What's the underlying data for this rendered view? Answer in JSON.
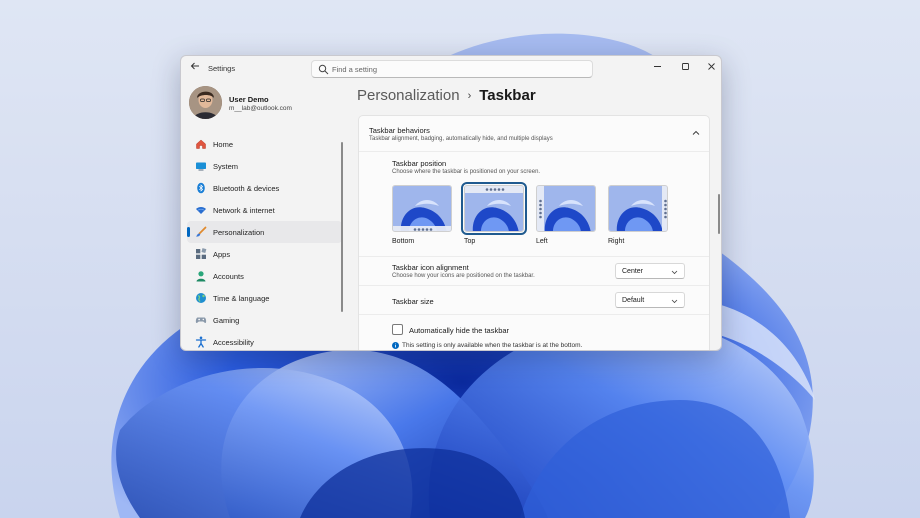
{
  "window": {
    "app_title": "Settings",
    "search_placeholder": "Find a setting"
  },
  "profile": {
    "name": "User Demo",
    "email": "m__lab@outlook.com"
  },
  "sidebar": {
    "items": [
      {
        "label": "Home",
        "icon": "home-icon",
        "color": "#d9534f"
      },
      {
        "label": "System",
        "icon": "system-icon",
        "color": "#1a8fd6"
      },
      {
        "label": "Bluetooth & devices",
        "icon": "bluetooth-icon",
        "color": "#1a7fd6"
      },
      {
        "label": "Network & internet",
        "icon": "wifi-icon",
        "color": "#2a6fd0"
      },
      {
        "label": "Personalization",
        "icon": "brush-icon",
        "color": "#e08a2e"
      },
      {
        "label": "Apps",
        "icon": "apps-icon",
        "color": "#5a6b7f"
      },
      {
        "label": "Accounts",
        "icon": "person-icon",
        "color": "#2aa67a"
      },
      {
        "label": "Time & language",
        "icon": "globe-icon",
        "color": "#1f8fd0"
      },
      {
        "label": "Gaming",
        "icon": "gamepad-icon",
        "color": "#7a8a9a"
      },
      {
        "label": "Accessibility",
        "icon": "accessibility-icon",
        "color": "#1a6fd0"
      }
    ],
    "active_index": 4
  },
  "breadcrumb": {
    "parent": "Personalization",
    "separator": "›",
    "current": "Taskbar"
  },
  "behaviors": {
    "title": "Taskbar behaviors",
    "subtitle": "Taskbar alignment, badging, automatically hide, and multiple displays",
    "position": {
      "title": "Taskbar position",
      "subtitle": "Choose where the taskbar is positioned on your screen.",
      "options": [
        "Bottom",
        "Top",
        "Left",
        "Right"
      ],
      "selected": "Top"
    },
    "alignment": {
      "title": "Taskbar icon alignment",
      "subtitle": "Choose how your icons are positioned on the taskbar.",
      "value": "Center"
    },
    "size": {
      "title": "Taskbar size",
      "value": "Default"
    },
    "autohide": {
      "label": "Automatically hide the taskbar",
      "checked": false,
      "info": "This setting is only available when the taskbar is at the bottom."
    }
  },
  "colors": {
    "accent": "#0067c0",
    "selected_outline": "#1f5a8f"
  }
}
